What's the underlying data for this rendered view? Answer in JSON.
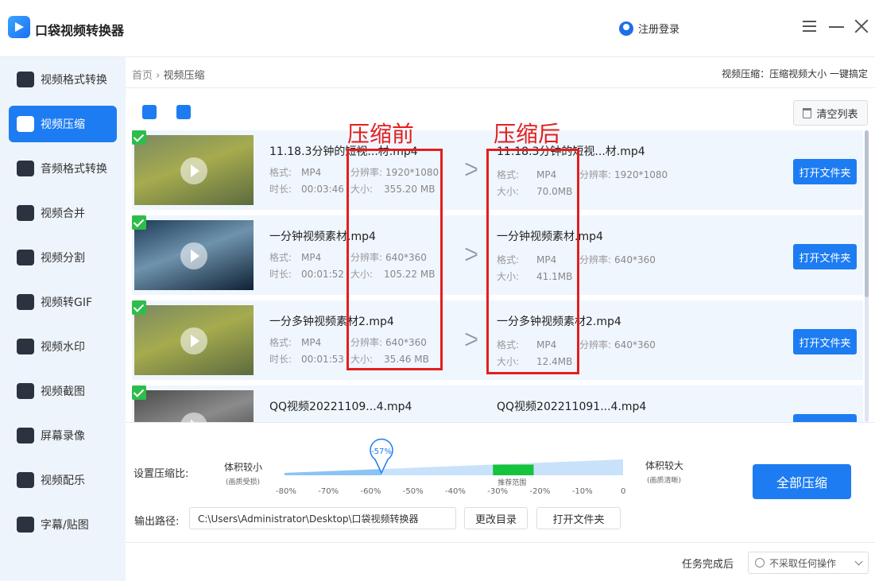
{
  "app": {
    "title": "口袋视频转换器",
    "login": "注册登录"
  },
  "sidebar": {
    "items": [
      {
        "label": "视频格式转换",
        "icon": "video-convert-icon"
      },
      {
        "label": "视频压缩",
        "icon": "compress-icon"
      },
      {
        "label": "音频格式转换",
        "icon": "audio-convert-icon"
      },
      {
        "label": "视频合并",
        "icon": "merge-icon"
      },
      {
        "label": "视频分割",
        "icon": "split-icon"
      },
      {
        "label": "视频转GIF",
        "icon": "gif-icon"
      },
      {
        "label": "视频水印",
        "icon": "watermark-icon"
      },
      {
        "label": "视频截图",
        "icon": "screenshot-icon"
      },
      {
        "label": "屏幕录像",
        "icon": "record-icon"
      },
      {
        "label": "视频配乐",
        "icon": "music-icon"
      },
      {
        "label": "字幕/贴图",
        "icon": "subtitle-icon"
      }
    ]
  },
  "header": {
    "breadcrumb_home": "首页",
    "breadcrumb_sep": "›",
    "breadcrumb_current": "视频压缩",
    "slogan": "视频压缩：压缩视频大小 一键搞定"
  },
  "toolbar": {
    "add_file_icon": "add-video-icon",
    "add_folder_icon": "add-folder-icon",
    "clear_label": "清空列表"
  },
  "labels": {
    "format": "格式:",
    "resolution": "分辨率:",
    "duration": "时长:",
    "size": "大小:",
    "open_folder": "打开文件夹"
  },
  "annotations": {
    "before": "压缩前",
    "after": "压缩后"
  },
  "files": [
    {
      "name": "11.18.3分钟的短视...材.mp4",
      "format": "MP4",
      "resolution": "1920*1080",
      "duration": "00:03:46",
      "size": "355.20 MB",
      "out_name": "11.18.3分钟的短视...材.mp4",
      "out_format": "MP4",
      "out_resolution": "1920*1080",
      "out_size": "70.0MB"
    },
    {
      "name": "一分钟视频素材.mp4",
      "format": "MP4",
      "resolution": "640*360",
      "duration": "00:01:52",
      "size": "105.22 MB",
      "out_name": "一分钟视频素材.mp4",
      "out_format": "MP4",
      "out_resolution": "640*360",
      "out_size": "41.1MB"
    },
    {
      "name": "一分多钟视频素材2.mp4",
      "format": "MP4",
      "resolution": "640*360",
      "duration": "00:01:53",
      "size": "35.46 MB",
      "out_name": "一分多钟视频素材2.mp4",
      "out_format": "MP4",
      "out_resolution": "640*360",
      "out_size": "12.4MB"
    },
    {
      "name": "QQ视频20221109...4.mp4",
      "out_name": "QQ视频202211091...4.mp4"
    }
  ],
  "compression": {
    "label": "设置压缩比:",
    "small_label": "体积较小",
    "small_sub": "(画质受损)",
    "big_label": "体积较大",
    "big_sub": "(画质清晰)",
    "value_label": "-57%",
    "value": -57,
    "recommended_label": "推荐范围",
    "recommended_range": [
      -30,
      -20
    ],
    "ticks": [
      "-80%",
      "-70%",
      "-60%",
      "-50%",
      "-40%",
      "-30%",
      "-20%",
      "-10%",
      "0"
    ]
  },
  "output": {
    "label": "输出路径:",
    "path": "C:\\Users\\Administrator\\Desktop\\口袋视频转换器",
    "change_dir": "更改目录",
    "open_folder": "打开文件夹"
  },
  "actions": {
    "compress_all": "全部压缩"
  },
  "task": {
    "label": "任务完成后",
    "selected": "不采取任何操作"
  },
  "colors": {
    "accent": "#1d7cf2",
    "annotation": "#e41e1e",
    "recommended": "#16c33c"
  }
}
